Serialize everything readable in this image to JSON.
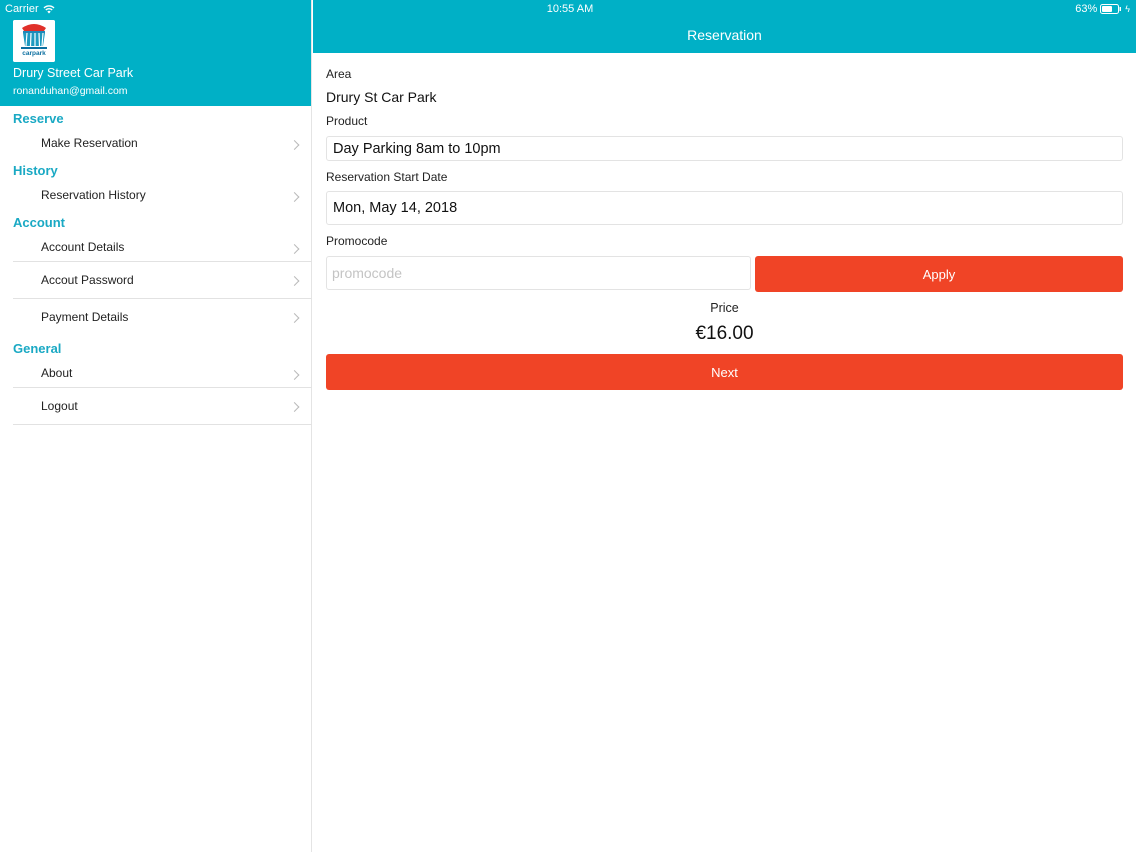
{
  "status_bar": {
    "carrier": "Carrier",
    "time": "10:55 AM",
    "battery": "63%"
  },
  "sidebar": {
    "user_name": "Drury Street Car Park",
    "user_email": "ronanduhan@gmail.com",
    "logo_text": "carpark",
    "sections": [
      {
        "title": "Reserve",
        "items": [
          "Make Reservation"
        ]
      },
      {
        "title": "History",
        "items": [
          "Reservation History"
        ]
      },
      {
        "title": "Account",
        "items": [
          "Account Details",
          "Accout Password",
          "Payment Details"
        ]
      },
      {
        "title": "General",
        "items": [
          "About",
          "Logout"
        ]
      }
    ]
  },
  "header": {
    "title": "Reservation"
  },
  "form": {
    "area_label": "Area",
    "area_value": "Drury St Car Park",
    "product_label": "Product",
    "product_value": "Day Parking 8am to 10pm",
    "start_date_label": "Reservation Start Date",
    "start_date_value": "Mon, May 14, 2018",
    "promocode_label": "Promocode",
    "promocode_placeholder": "promocode",
    "promocode_value": "",
    "apply_label": "Apply",
    "price_label": "Price",
    "price_value": "€16.00",
    "next_label": "Next"
  },
  "colors": {
    "header_bg": "#00b0c6",
    "section_title": "#1aa9c4",
    "button_bg": "#f04426"
  }
}
